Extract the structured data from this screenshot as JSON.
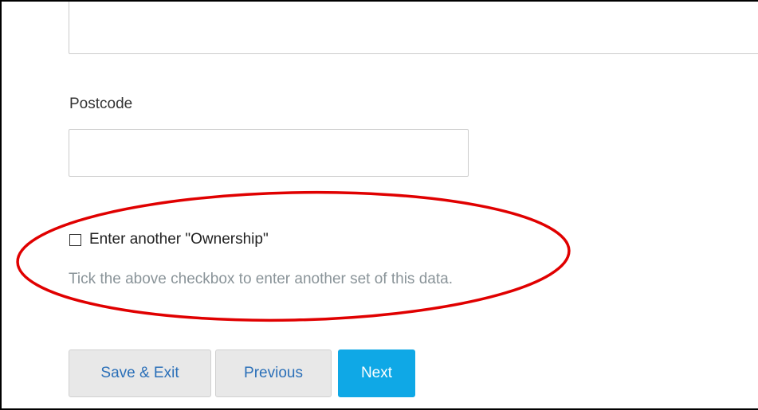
{
  "form": {
    "top_field_value": "",
    "postcode_label": "Postcode",
    "postcode_value": "",
    "checkbox_label": "Enter another \"Ownership\"",
    "checkbox_checked": false,
    "help_text": "Tick the above checkbox to enter another set of this data."
  },
  "actions": {
    "save_exit_label": "Save & Exit",
    "previous_label": "Previous",
    "next_label": "Next"
  },
  "colors": {
    "annotation": "#e00000",
    "next_button": "#0fa8e6",
    "secondary_button_text": "#2a6fb8",
    "help_text": "#8a9499"
  }
}
